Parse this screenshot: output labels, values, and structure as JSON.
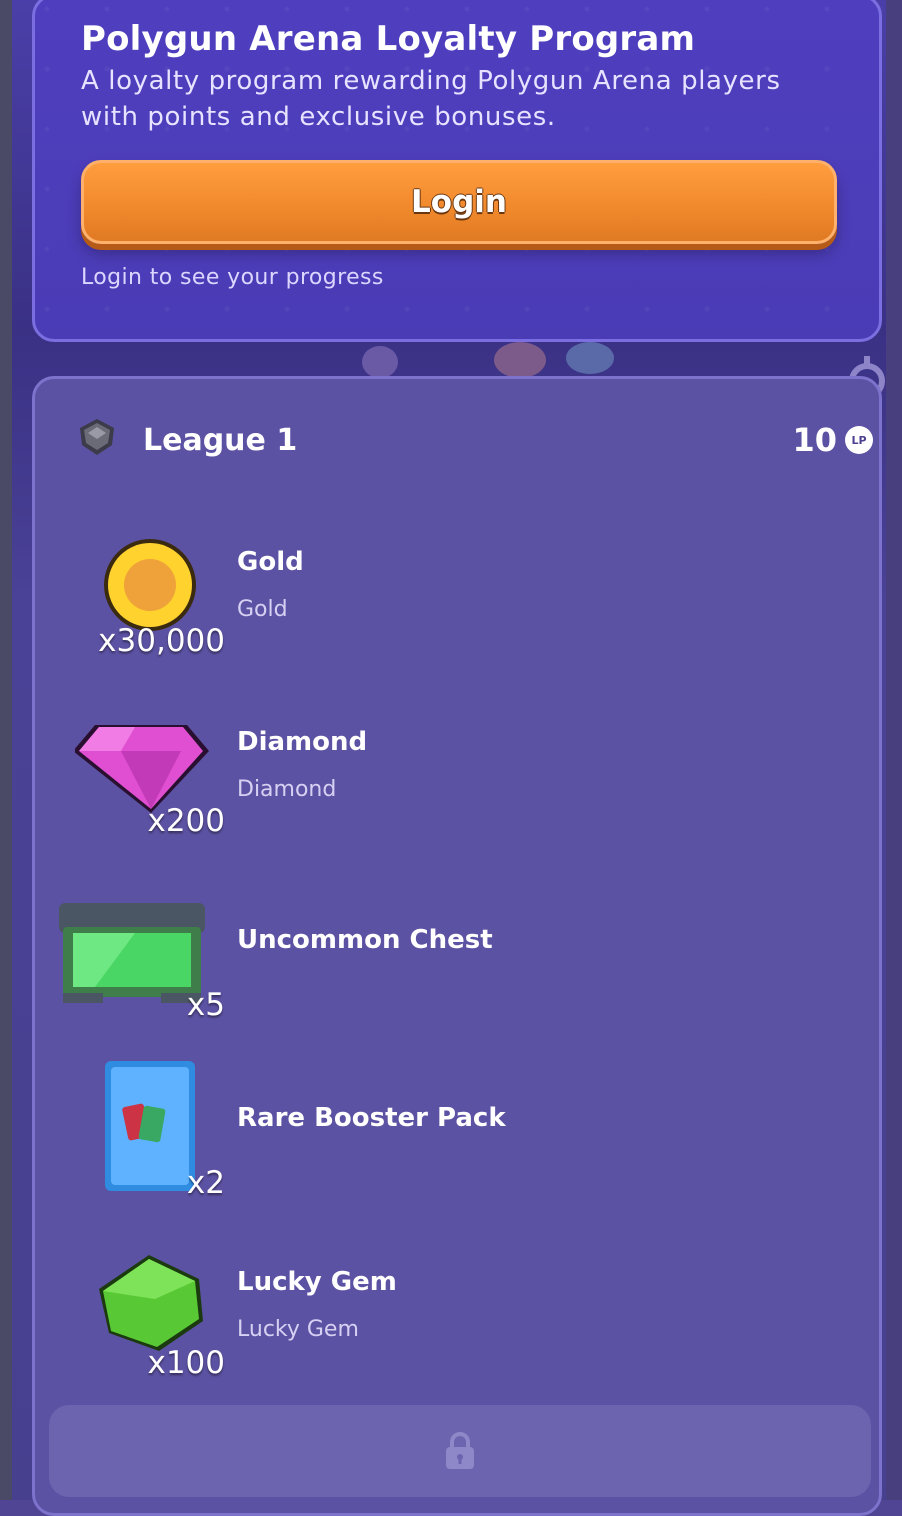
{
  "program": {
    "title": "Polygun Arena Loyalty Program",
    "description": "A loyalty program rewarding Polygun Arena players with points and exclusive bonuses.",
    "login_label": "Login",
    "progress_hint": "Login to see your progress"
  },
  "league": {
    "name": "League 1",
    "points": "10",
    "points_unit": "LP",
    "rewards": [
      {
        "name": "Gold",
        "subtitle": "Gold",
        "quantity": "x30,000",
        "icon": "gold-coin-icon"
      },
      {
        "name": "Diamond",
        "subtitle": "Diamond",
        "quantity": "x200",
        "icon": "diamond-icon"
      },
      {
        "name": "Uncommon Chest",
        "subtitle": "",
        "quantity": "x5",
        "icon": "chest-icon"
      },
      {
        "name": "Rare Booster Pack",
        "subtitle": "",
        "quantity": "x2",
        "icon": "booster-pack-icon"
      },
      {
        "name": "Lucky Gem",
        "subtitle": "Lucky Gem",
        "quantity": "x100",
        "icon": "lucky-gem-icon"
      }
    ],
    "locked_icon": "lock-icon"
  },
  "colors": {
    "accent": "#f0882c",
    "card_bg": "#5c52a3",
    "header_bg": "#4a3cb5"
  }
}
